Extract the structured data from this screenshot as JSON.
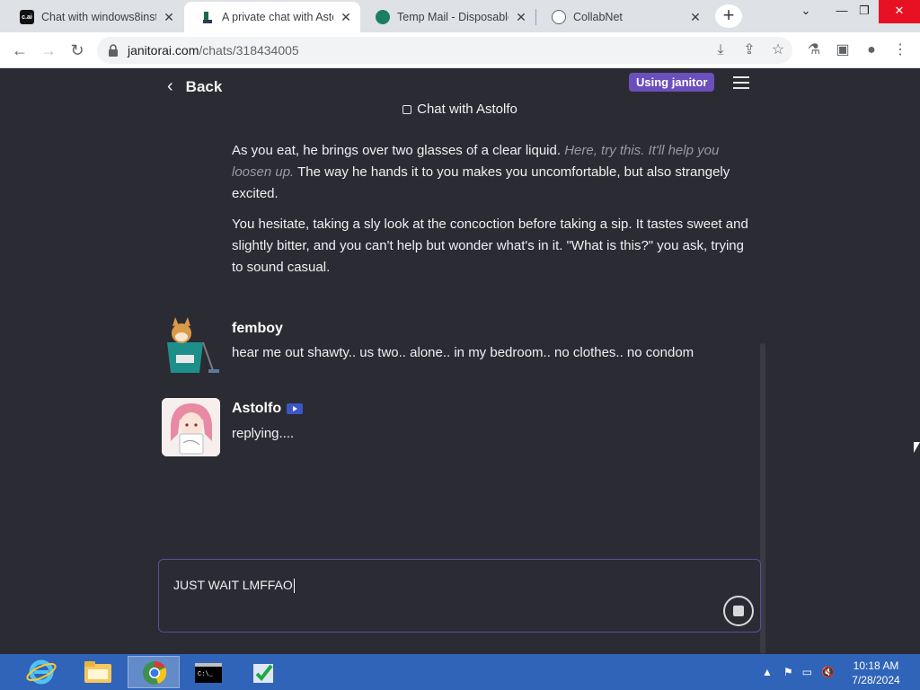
{
  "browser": {
    "tabs": [
      {
        "title": "Chat with windows8inst",
        "favicon": "c.ai"
      },
      {
        "title": "A private chat with Asto",
        "favicon": "janitor"
      },
      {
        "title": "Temp Mail - Disposable",
        "favicon": "tempmail"
      },
      {
        "title": "CollabNet",
        "favicon": "globe"
      }
    ],
    "url_host": "janitorai.com",
    "url_path": "/chats/318434005"
  },
  "header": {
    "back_label": "Back",
    "badge_label": "Using janitor",
    "chat_title": "Chat with Astolfo"
  },
  "messages": {
    "paragraph1_plain": "As you eat, he brings over two glasses of a clear liquid.",
    "paragraph1_italic": "Here, try this. It'll help you loosen up.",
    "paragraph1_tail": "The way he hands it to you makes you uncomfortable, but also strangely excited.",
    "paragraph2": "You hesitate, taking a sly look at the concoction before taking a sip. It tastes sweet and slightly bitter, and you can't help but wonder what's in it. \"What is this?\" you ask, trying to sound casual.",
    "user_name": "femboy",
    "user_text": "hear me out shawty.. us two.. alone.. in my bedroom.. no clothes.. no condom",
    "bot_name": "Astolfo",
    "bot_text": "replying...."
  },
  "composer": {
    "value": "JUST WAIT LMFFAO"
  },
  "taskbar": {
    "time": "10:18 AM",
    "date": "7/28/2024"
  },
  "colors": {
    "page_bg": "#2b2b33",
    "accent": "#6b4fbb",
    "taskbar": "#2f64b8"
  }
}
